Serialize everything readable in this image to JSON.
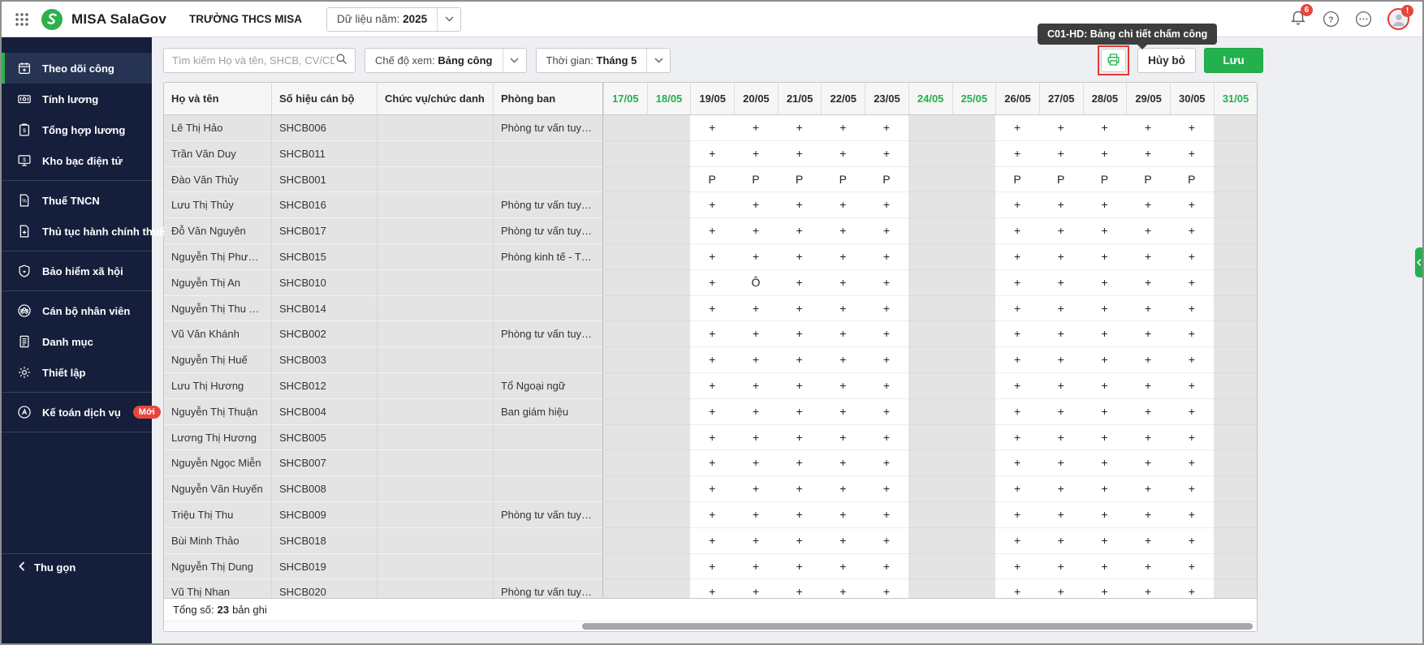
{
  "header": {
    "app_title": "MISA SalaGov",
    "org_name": "TRƯỜNG THCS MISA",
    "year_label": "Dữ liệu năm:",
    "year_value": "2025",
    "notification_count": "6",
    "avatar_badge": "!"
  },
  "tooltip": {
    "text": "C01-HD: Bảng chi tiết chấm công"
  },
  "sidebar": {
    "items": [
      {
        "id": "theo-doi-cong",
        "label": "Theo dõi công",
        "icon": "calendar-icon",
        "active": true
      },
      {
        "id": "tinh-luong",
        "label": "Tính lương",
        "icon": "money-icon"
      },
      {
        "id": "tong-hop-luong",
        "label": "Tổng hợp lương",
        "icon": "clipboard-icon"
      },
      {
        "id": "kho-bac-dien-tu",
        "label": "Kho bạc điện tử",
        "icon": "monitor-icon"
      },
      {
        "divider": true
      },
      {
        "id": "thue-tncn",
        "label": "Thuế TNCN",
        "icon": "doc-percent-icon"
      },
      {
        "id": "thu-tuc-hanh-chinh-thue",
        "label": "Thủ tục hành chính thuế",
        "icon": "doc-plus-icon"
      },
      {
        "divider": true
      },
      {
        "id": "bao-hiem-xa-hoi",
        "label": "Bảo hiểm xã hội",
        "icon": "shield-icon"
      },
      {
        "divider": true
      },
      {
        "id": "can-bo-nhan-vien",
        "label": "Cán bộ nhân viên",
        "icon": "people-icon"
      },
      {
        "id": "danh-muc",
        "label": "Danh mục",
        "icon": "list-icon"
      },
      {
        "id": "thiet-lap",
        "label": "Thiết lập",
        "icon": "gear-icon"
      },
      {
        "divider": true
      },
      {
        "id": "ke-toan-dich-vu",
        "label": "Kế toán dịch vụ",
        "icon": "service-icon",
        "badge": "Mới"
      },
      {
        "divider": true
      }
    ],
    "collapse_label": "Thu gọn"
  },
  "toolbar": {
    "search_placeholder": "Tìm kiếm Họ và tên, SHCB, CV/CD, Ph...",
    "view_label": "Chế độ xem:",
    "view_value": "Bảng công",
    "time_label": "Thời gian:",
    "time_value": "Tháng 5",
    "cancel_label": "Hủy bỏ",
    "save_label": "Lưu"
  },
  "table": {
    "fixed_columns": [
      "Họ và tên",
      "Số hiệu cán bộ",
      "Chức vụ/chức danh",
      "Phòng ban"
    ],
    "dates": [
      {
        "label": "17/05",
        "weekend": true
      },
      {
        "label": "18/05",
        "weekend": true
      },
      {
        "label": "19/05",
        "weekend": false
      },
      {
        "label": "20/05",
        "weekend": false
      },
      {
        "label": "21/05",
        "weekend": false
      },
      {
        "label": "22/05",
        "weekend": false
      },
      {
        "label": "23/05",
        "weekend": false
      },
      {
        "label": "24/05",
        "weekend": true
      },
      {
        "label": "25/05",
        "weekend": true
      },
      {
        "label": "26/05",
        "weekend": false
      },
      {
        "label": "27/05",
        "weekend": false
      },
      {
        "label": "28/05",
        "weekend": false
      },
      {
        "label": "29/05",
        "weekend": false
      },
      {
        "label": "30/05",
        "weekend": false
      },
      {
        "label": "31/05",
        "weekend": true
      }
    ],
    "rows": [
      {
        "name": "Lê Thị Hảo",
        "code": "SHCB006",
        "position": "",
        "department": "Phòng tư vấn tuyển si...",
        "marks": [
          "",
          "",
          "+",
          "+",
          "+",
          "+",
          "+",
          "",
          "",
          "+",
          "+",
          "+",
          "+",
          "+",
          ""
        ]
      },
      {
        "name": "Trần Văn Duy",
        "code": "SHCB011",
        "position": "",
        "department": "",
        "marks": [
          "",
          "",
          "+",
          "+",
          "+",
          "+",
          "+",
          "",
          "",
          "+",
          "+",
          "+",
          "+",
          "+",
          ""
        ]
      },
      {
        "name": "Đào Văn Thủy",
        "code": "SHCB001",
        "position": "",
        "department": "",
        "marks": [
          "",
          "",
          "P",
          "P",
          "P",
          "P",
          "P",
          "",
          "",
          "P",
          "P",
          "P",
          "P",
          "P",
          ""
        ]
      },
      {
        "name": "Lưu Thị Thủy",
        "code": "SHCB016",
        "position": "",
        "department": "Phòng tư vấn tuyển si...",
        "marks": [
          "",
          "",
          "+",
          "+",
          "+",
          "+",
          "+",
          "",
          "",
          "+",
          "+",
          "+",
          "+",
          "+",
          ""
        ]
      },
      {
        "name": "Đỗ Văn Nguyên",
        "code": "SHCB017",
        "position": "",
        "department": "Phòng tư vấn tuyển si...",
        "marks": [
          "",
          "",
          "+",
          "+",
          "+",
          "+",
          "+",
          "",
          "",
          "+",
          "+",
          "+",
          "+",
          "+",
          ""
        ]
      },
      {
        "name": "Nguyễn Thị Phương ...",
        "code": "SHCB015",
        "position": "",
        "department": "Phòng kinh tế - THCS...",
        "marks": [
          "",
          "",
          "+",
          "+",
          "+",
          "+",
          "+",
          "",
          "",
          "+",
          "+",
          "+",
          "+",
          "+",
          ""
        ]
      },
      {
        "name": "Nguyễn Thị An",
        "code": "SHCB010",
        "position": "",
        "department": "",
        "marks": [
          "",
          "",
          "+",
          "Ô",
          "+",
          "+",
          "+",
          "",
          "",
          "+",
          "+",
          "+",
          "+",
          "+",
          ""
        ]
      },
      {
        "name": "Nguyễn Thị Thu Thúy",
        "code": "SHCB014",
        "position": "",
        "department": "",
        "marks": [
          "",
          "",
          "+",
          "+",
          "+",
          "+",
          "+",
          "",
          "",
          "+",
          "+",
          "+",
          "+",
          "+",
          ""
        ]
      },
      {
        "name": "Vũ Văn Khánh",
        "code": "SHCB002",
        "position": "",
        "department": "Phòng tư vấn tuyển si...",
        "marks": [
          "",
          "",
          "+",
          "+",
          "+",
          "+",
          "+",
          "",
          "",
          "+",
          "+",
          "+",
          "+",
          "+",
          ""
        ]
      },
      {
        "name": "Nguyễn Thị Huế",
        "code": "SHCB003",
        "position": "",
        "department": "",
        "marks": [
          "",
          "",
          "+",
          "+",
          "+",
          "+",
          "+",
          "",
          "",
          "+",
          "+",
          "+",
          "+",
          "+",
          ""
        ]
      },
      {
        "name": "Lưu Thị Hương",
        "code": "SHCB012",
        "position": "",
        "department": "Tổ Ngoại ngữ",
        "marks": [
          "",
          "",
          "+",
          "+",
          "+",
          "+",
          "+",
          "",
          "",
          "+",
          "+",
          "+",
          "+",
          "+",
          ""
        ]
      },
      {
        "name": "Nguyễn Thị Thuận",
        "code": "SHCB004",
        "position": "",
        "department": "Ban giám hiệu",
        "marks": [
          "",
          "",
          "+",
          "+",
          "+",
          "+",
          "+",
          "",
          "",
          "+",
          "+",
          "+",
          "+",
          "+",
          ""
        ]
      },
      {
        "name": "Lương Thị Hương",
        "code": "SHCB005",
        "position": "",
        "department": "",
        "marks": [
          "",
          "",
          "+",
          "+",
          "+",
          "+",
          "+",
          "",
          "",
          "+",
          "+",
          "+",
          "+",
          "+",
          ""
        ]
      },
      {
        "name": "Nguyễn Ngọc Miễn",
        "code": "SHCB007",
        "position": "",
        "department": "",
        "marks": [
          "",
          "",
          "+",
          "+",
          "+",
          "+",
          "+",
          "",
          "",
          "+",
          "+",
          "+",
          "+",
          "+",
          ""
        ]
      },
      {
        "name": "Nguyễn Văn Huyến",
        "code": "SHCB008",
        "position": "",
        "department": "",
        "marks": [
          "",
          "",
          "+",
          "+",
          "+",
          "+",
          "+",
          "",
          "",
          "+",
          "+",
          "+",
          "+",
          "+",
          ""
        ]
      },
      {
        "name": "Triệu Thị Thu",
        "code": "SHCB009",
        "position": "",
        "department": "Phòng tư vấn tuyển si...",
        "marks": [
          "",
          "",
          "+",
          "+",
          "+",
          "+",
          "+",
          "",
          "",
          "+",
          "+",
          "+",
          "+",
          "+",
          ""
        ]
      },
      {
        "name": "Bùi Minh Thảo",
        "code": "SHCB018",
        "position": "",
        "department": "",
        "marks": [
          "",
          "",
          "+",
          "+",
          "+",
          "+",
          "+",
          "",
          "",
          "+",
          "+",
          "+",
          "+",
          "+",
          ""
        ]
      },
      {
        "name": "Nguyễn Thị Dung",
        "code": "SHCB019",
        "position": "",
        "department": "",
        "marks": [
          "",
          "",
          "+",
          "+",
          "+",
          "+",
          "+",
          "",
          "",
          "+",
          "+",
          "+",
          "+",
          "+",
          ""
        ]
      },
      {
        "name": "Vũ Thị Nhan",
        "code": "SHCB020",
        "position": "",
        "department": "Phòng tư vấn tuyển si...",
        "marks": [
          "",
          "",
          "+",
          "+",
          "+",
          "+",
          "+",
          "",
          "",
          "+",
          "+",
          "+",
          "+",
          "+",
          ""
        ]
      }
    ]
  },
  "footer": {
    "total_label": "Tổng số:",
    "total_value": "23",
    "unit": "bản ghi"
  },
  "colors": {
    "accent_green": "#23b14d",
    "sidebar_bg": "#151f3c",
    "badge_red": "#e8453c",
    "highlight_red": "#e53935",
    "tooltip_bg": "#3d3d3d",
    "weekend_cell": "#e4e4e4"
  }
}
